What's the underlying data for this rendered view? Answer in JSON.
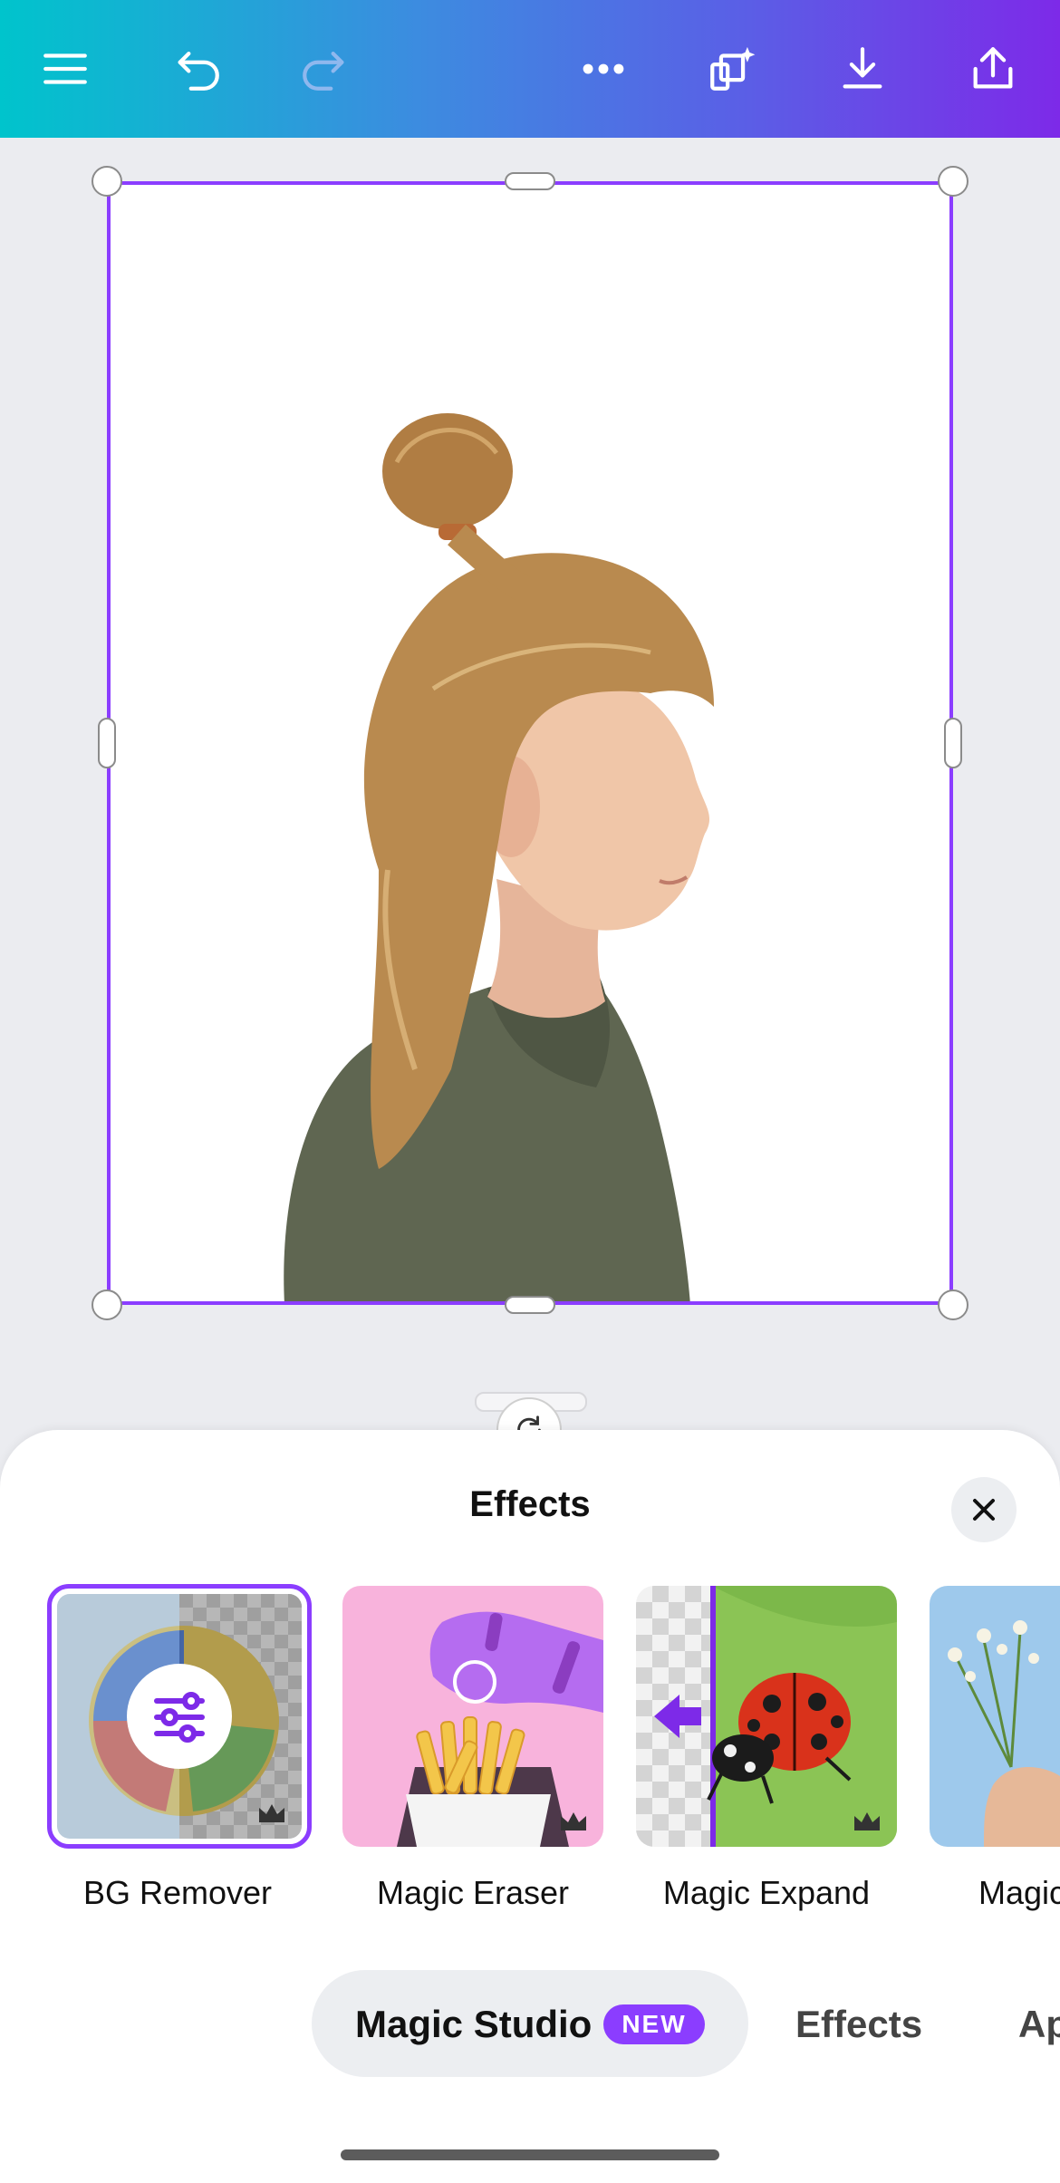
{
  "toolbar": {
    "icons": [
      "menu-icon",
      "undo-icon",
      "redo-icon",
      "more-icon",
      "magic-resize-icon",
      "download-icon",
      "share-icon"
    ]
  },
  "effects_panel": {
    "title": "Effects",
    "tiles": [
      {
        "label": "BG Remover",
        "selected": true,
        "pro": true
      },
      {
        "label": "Magic Eraser",
        "selected": false,
        "pro": true
      },
      {
        "label": "Magic Expand",
        "selected": false,
        "pro": true
      },
      {
        "label": "Magic",
        "selected": false,
        "pro": false
      }
    ]
  },
  "tabs": {
    "magic_studio": "Magic Studio",
    "new_badge": "NEW",
    "effects": "Effects",
    "apps": "Ap"
  },
  "colors": {
    "accent": "#8b3dff",
    "gradient_start": "#00c4cc",
    "gradient_end": "#7d2ae8"
  }
}
